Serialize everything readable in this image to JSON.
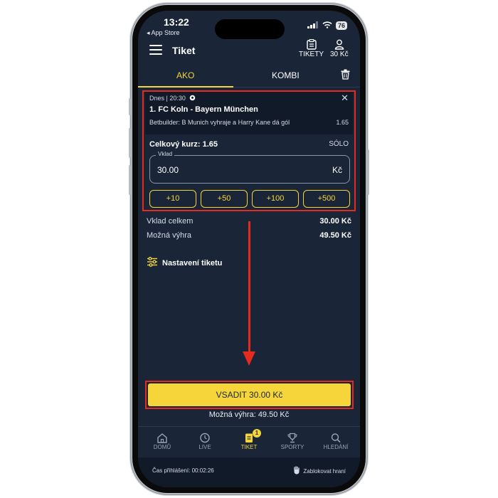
{
  "status_bar": {
    "time": "13:22",
    "back_app": "◂ App Store",
    "battery": "76"
  },
  "header": {
    "title": "Tiket",
    "tickets_label": "TIKETY",
    "balance": "30 Kč"
  },
  "tabs": {
    "ako": "AKO",
    "kombi": "KOMBI"
  },
  "bet": {
    "time": "Dnes | 20:30",
    "match": "1. FC Koln - Bayern München",
    "market": "Betbuilder: B Munich vyhraje a Harry Kane dá gól",
    "odds": "1.65",
    "total_odds": "Celkový kurz: 1.65",
    "mode": "SÓLO",
    "stake_label": "Vklad",
    "stake_value": "30.00",
    "currency": "Kč",
    "quick_amounts": [
      "+10",
      "+50",
      "+100",
      "+500"
    ]
  },
  "summary": {
    "stake_total_label": "Vklad celkem",
    "stake_total_value": "30.00 Kč",
    "possible_win_label": "Možná výhra",
    "possible_win_value": "49.50 Kč",
    "settings_label": "Nastavení tiketu"
  },
  "place_bet": {
    "button": "VSADIT 30.00 Kč",
    "possible": "Možná výhra: 49.50 Kč"
  },
  "nav": {
    "home": "DOMŮ",
    "live": "LIVE",
    "ticket": "TIKET",
    "ticket_badge": "1",
    "sports": "SPORTY",
    "search": "HLEDÁNÍ"
  },
  "footer": {
    "login_time": "Čas přihlášení: 00:02:26",
    "block": "Zablokovat hraní"
  },
  "colors": {
    "background": "#1a2638",
    "accent": "#f5d53a",
    "highlight": "#e32b1f"
  }
}
